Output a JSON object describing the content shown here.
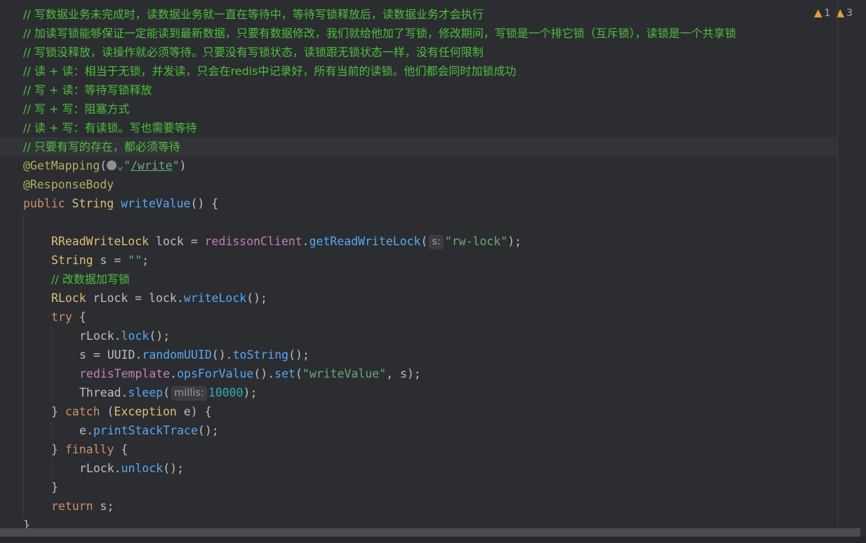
{
  "warnings": [
    {
      "icon": "warning-icon",
      "count": "1"
    },
    {
      "icon": "warning-icon",
      "count": "3"
    }
  ],
  "code": {
    "c1": "// 写数据业务未完成时，读数据业务就一直在等待中，等待写锁释放后，读数据业务才会执行",
    "c2": "// 加读写锁能够保证一定能读到最新数据，只要有数据修改，我们就给他加了写锁，修改期间，写锁是一个排它锁（互斥锁），读锁是一个共享锁",
    "c3": "// 写锁没释放，读操作就必须等待。只要没有写锁状态，读锁跟无锁状态一样，没有任何限制",
    "c4": "// 读 + 读：相当于无锁，并发读，只会在redis中记录好，所有当前的读锁。他们都会同时加锁成功",
    "c5": "// 写 + 读：等待写锁释放",
    "c6": "// 写 + 写：阻塞方式",
    "c7": "// 读 + 写：有读锁。写也需要等待",
    "c8": "// 只要有写的存在，都必须等待",
    "ann_get": "@GetMapping",
    "get_path": "/write",
    "ann_resp": "@ResponseBody",
    "kw_public": "public",
    "type_string": "String",
    "method_name": "writeValue",
    "rrwl_type": "RReadWriteLock",
    "var_lock": "lock",
    "field_client": "redissonClient",
    "m_get_rwl": "getReadWriteLock",
    "hint_s": "s:",
    "str_rwlock": "\"rw-lock\"",
    "var_s": "s",
    "str_empty": "\"\"",
    "c9": "// 改数据加写锁",
    "rlock_type": "RLock",
    "var_rlock": "rLock",
    "m_writelock": "writeLock",
    "kw_try": "try",
    "m_lock": "lock",
    "cls_uuid": "UUID",
    "m_random": "randomUUID",
    "m_tostring": "toString",
    "field_template": "redisTemplate",
    "m_ops": "opsForValue",
    "m_set": "set",
    "str_wv": "\"writeValue\"",
    "cls_thread": "Thread",
    "m_sleep": "sleep",
    "hint_millis": "millis:",
    "num_sleep": "10000",
    "kw_catch": "catch",
    "cls_exception": "Exception",
    "var_e": "e",
    "m_pst": "printStackTrace",
    "kw_finally": "finally",
    "m_unlock": "unlock",
    "kw_return": "return"
  }
}
